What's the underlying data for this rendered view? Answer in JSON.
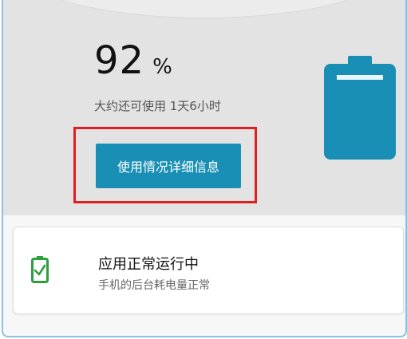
{
  "battery": {
    "percent_value": "92",
    "percent_sign": "%",
    "remaining": "大约还可使用 1天6小时",
    "level": 0.92
  },
  "actions": {
    "details_label": "使用情况详细信息"
  },
  "status": {
    "title": "应用正常运行中",
    "subtitle": "手机的后台耗电量正常"
  },
  "colors": {
    "accent": "#1a8fb5",
    "highlight": "#e02020",
    "ok_green": "#2e9e3e"
  },
  "icons": {
    "battery": "battery-icon",
    "battery_check": "battery-check-icon"
  }
}
